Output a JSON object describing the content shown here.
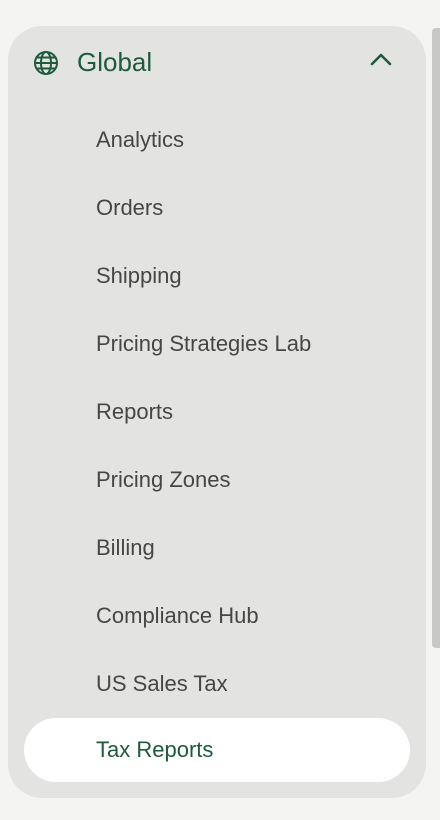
{
  "section": {
    "title": "Global",
    "icon": "globe-icon",
    "collapse_icon": "chevron-up-icon",
    "expanded": true
  },
  "nav": {
    "items": [
      {
        "label": "Analytics"
      },
      {
        "label": "Orders"
      },
      {
        "label": "Shipping"
      },
      {
        "label": "Pricing Strategies Lab"
      },
      {
        "label": "Reports"
      },
      {
        "label": "Pricing Zones"
      },
      {
        "label": "Billing"
      },
      {
        "label": "Compliance Hub"
      },
      {
        "label": "US Sales Tax"
      },
      {
        "label": "Tax Reports"
      }
    ],
    "active_label": "Tax Reports"
  },
  "colors": {
    "accent": "#1f5a3a",
    "panel_bg": "#e3e4e2",
    "active_bg": "#ffffff",
    "text": "#464646"
  }
}
